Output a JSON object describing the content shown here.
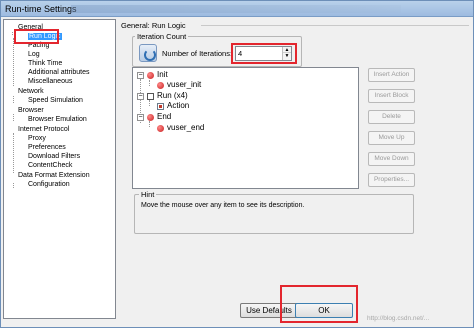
{
  "window": {
    "title": "Run-time Settings"
  },
  "tree": {
    "items": [
      {
        "label": "General"
      },
      {
        "label": "Run Logic"
      },
      {
        "label": "Pacing"
      },
      {
        "label": "Log"
      },
      {
        "label": "Think Time"
      },
      {
        "label": "Additional attributes"
      },
      {
        "label": "Miscellaneous"
      },
      {
        "label": "Network"
      },
      {
        "label": "Speed Simulation"
      },
      {
        "label": "Browser"
      },
      {
        "label": "Browser Emulation"
      },
      {
        "label": "Internet Protocol"
      },
      {
        "label": "Proxy"
      },
      {
        "label": "Preferences"
      },
      {
        "label": "Download Filters"
      },
      {
        "label": "ContentCheck"
      },
      {
        "label": "Data Format Extension"
      },
      {
        "label": "Configuration"
      }
    ]
  },
  "panel": {
    "title": "General: Run Logic",
    "iteration_group": "Iteration Count",
    "iterations_label": "Number of Iterations:",
    "iterations_value": "4"
  },
  "flow": {
    "items": [
      {
        "label": "Init"
      },
      {
        "label": "vuser_init"
      },
      {
        "label": "Run (x4)"
      },
      {
        "label": "Action"
      },
      {
        "label": "End"
      },
      {
        "label": "vuser_end"
      }
    ]
  },
  "side_buttons": [
    "Insert Action",
    "Insert Block",
    "Delete",
    "Move Up",
    "Move Down",
    "Properties..."
  ],
  "hint": {
    "title": "Hint",
    "text": "Move the mouse over any item to see its description."
  },
  "footer": {
    "defaults_label": "Use Defaults",
    "ok_label": "OK"
  },
  "highlight_color": "#e3262e",
  "selection_color": "#3399ff"
}
